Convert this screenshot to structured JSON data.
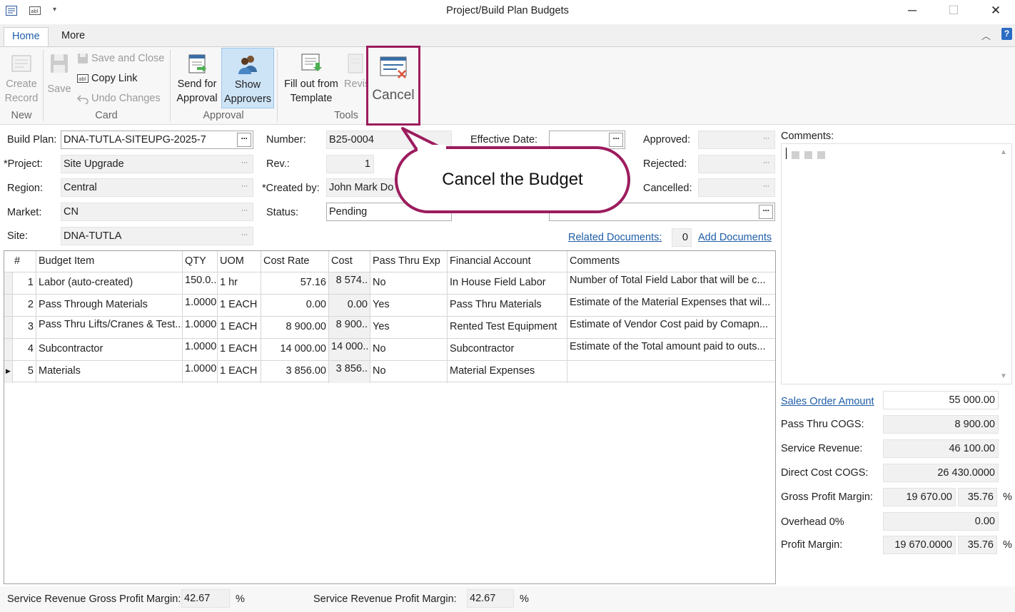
{
  "window": {
    "title": "Project/Build Plan Budgets",
    "minimize": "─",
    "maximize": "☐",
    "close": "✕"
  },
  "tabs": [
    {
      "label": "Home"
    },
    {
      "label": "More"
    }
  ],
  "ribbon": {
    "create_record": "Create Record",
    "save": "Save",
    "save_and_close": "Save and Close",
    "copy_link": "Copy Link",
    "undo_changes": "Undo Changes",
    "send_for_approval": "Send for Approval",
    "show_approvers": "Show Approvers",
    "fill_out_template": "Fill out from Template",
    "revise": "Revis",
    "cancel": "Cancel",
    "groups": {
      "new": "New",
      "card": "Card",
      "approval": "Approval",
      "tools": "Tools"
    }
  },
  "callout": {
    "text": "Cancel the Budget"
  },
  "form": {
    "build_plan_label": "Build Plan:",
    "build_plan": "DNA-TUTLA-SITEUPG-2025-7",
    "project_label": "*Project:",
    "project": "Site Upgrade",
    "region_label": "Region:",
    "region": "Central",
    "market_label": "Market:",
    "market": "CN",
    "site_label": "Site:",
    "site": "DNA-TUTLA",
    "number_label": "Number:",
    "number": "B25-0004",
    "rev_label": "Rev.:",
    "rev": "1",
    "created_by_label": "*Created by:",
    "created_by": "John Mark Do",
    "status_label": "Status:",
    "status": "Pending",
    "effective_date_label": "Effective Date:",
    "effective_date": "",
    "approved_label": "Approved:",
    "rejected_label": "Rejected:",
    "cancelled_label": "Cancelled:",
    "related_documents": "Related Documents:",
    "related_count": "0",
    "add_documents": "Add Documents",
    "comments_label": "Comments:"
  },
  "grid": {
    "headers": [
      "#",
      "Budget Item",
      "QTY",
      "UOM",
      "Cost Rate",
      "Cost",
      "Pass Thru Exp",
      "Financial Account",
      "Comments"
    ],
    "rows": [
      {
        "n": "1",
        "item": "Labor (auto-created)",
        "qty": "150.0...",
        "uom": "1 hr",
        "rate": "57.16",
        "cost": "8 574..",
        "pass": "No",
        "account": "In House Field Labor",
        "comments": "Number of Total Field Labor that will be c..."
      },
      {
        "n": "2",
        "item": "Pass Through Materials",
        "qty": "1.0000",
        "uom": "1 EACH",
        "rate": "0.00",
        "cost": "0.00",
        "pass": "Yes",
        "account": "Pass Thru Materials",
        "comments": "Estimate of the Material Expenses that wil..."
      },
      {
        "n": "3",
        "item": "Pass Thru Lifts/Cranes & Test...",
        "qty": "1.0000",
        "uom": "1 EACH",
        "rate": "8 900.00",
        "cost": "8 900..",
        "pass": "Yes",
        "account": "Rented Test Equipment",
        "comments": "Estimate of Vendor Cost paid by Comapn..."
      },
      {
        "n": "4",
        "item": "Subcontractor",
        "qty": "1.0000",
        "uom": "1 EACH",
        "rate": "14 000.00",
        "cost": "14 000..",
        "pass": "No",
        "account": "Subcontractor",
        "comments": "Estimate of the Total amount paid to outs..."
      },
      {
        "n": "5",
        "item": "Materials",
        "qty": "1.0000",
        "uom": "1 EACH",
        "rate": "3 856.00",
        "cost": "3 856..",
        "pass": "No",
        "account": "Material Expenses",
        "comments": ""
      }
    ]
  },
  "summary": {
    "sales_order_amount_label": "Sales Order Amount",
    "sales_order_amount": "55 000.00",
    "pass_thru_cogs_label": "Pass Thru COGS:",
    "pass_thru_cogs": "8 900.00",
    "service_revenue_label": "Service Revenue:",
    "service_revenue": "46 100.00",
    "direct_cost_label": "Direct Cost COGS:",
    "direct_cost": "26 430.0000",
    "gross_profit_label": "Gross Profit Margin:",
    "gross_profit": "19 670.00",
    "gross_profit_pct": "35.76",
    "overhead_label": "Overhead 0%",
    "overhead": "0.00",
    "profit_margin_label": "Profit Margin:",
    "profit_margin": "19 670.0000",
    "profit_margin_pct": "35.76",
    "pct": "%"
  },
  "footer": {
    "srgpm_label": "Service Revenue Gross Profit Margin:",
    "srgpm": "42.67",
    "srpm_label": "Service Revenue Profit Margin:",
    "srpm": "42.67",
    "pct": "%"
  },
  "colors": {
    "accent": "#1f5ea8",
    "highlight": "#9c1c5e",
    "selected": "#cde4f7"
  }
}
